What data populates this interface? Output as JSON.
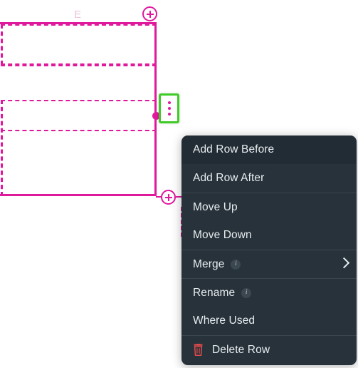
{
  "canvas": {
    "column_letter": "E",
    "add_row_top_icon": "plus-circle-icon",
    "add_row_bottom_icon": "plus-circle-icon",
    "row_handle_icon": "handle-dot-icon",
    "kebab_icon": "kebab-menu-icon",
    "selection_color": "#3FCB26",
    "table_color": "#E0189C"
  },
  "context_menu": {
    "items": [
      {
        "label": "Add Row Before",
        "icon": null,
        "badge": null,
        "submenu": false,
        "danger": false,
        "hover": true,
        "divider_above": false
      },
      {
        "label": "Add Row After",
        "icon": null,
        "badge": null,
        "submenu": false,
        "danger": false,
        "hover": false,
        "divider_above": false
      },
      {
        "label": "Move Up",
        "icon": null,
        "badge": null,
        "submenu": false,
        "danger": false,
        "hover": false,
        "divider_above": true
      },
      {
        "label": "Move Down",
        "icon": null,
        "badge": null,
        "submenu": false,
        "danger": false,
        "hover": false,
        "divider_above": false
      },
      {
        "label": "Merge",
        "icon": null,
        "badge": "i",
        "submenu": true,
        "danger": false,
        "hover": false,
        "divider_above": true
      },
      {
        "label": "Rename",
        "icon": null,
        "badge": "i",
        "submenu": false,
        "danger": false,
        "hover": false,
        "divider_above": true
      },
      {
        "label": "Where Used",
        "icon": null,
        "badge": null,
        "submenu": false,
        "danger": false,
        "hover": false,
        "divider_above": false
      },
      {
        "label": "Delete Row",
        "icon": "trash-icon",
        "badge": null,
        "submenu": false,
        "danger": true,
        "hover": false,
        "divider_above": true
      }
    ],
    "background_color": "#27323A",
    "text_color": "#E8EDF0",
    "danger_color": "#E04A4A",
    "submenu_indicator_icon": "chevron-right-icon",
    "badge_icon": "info-icon"
  }
}
